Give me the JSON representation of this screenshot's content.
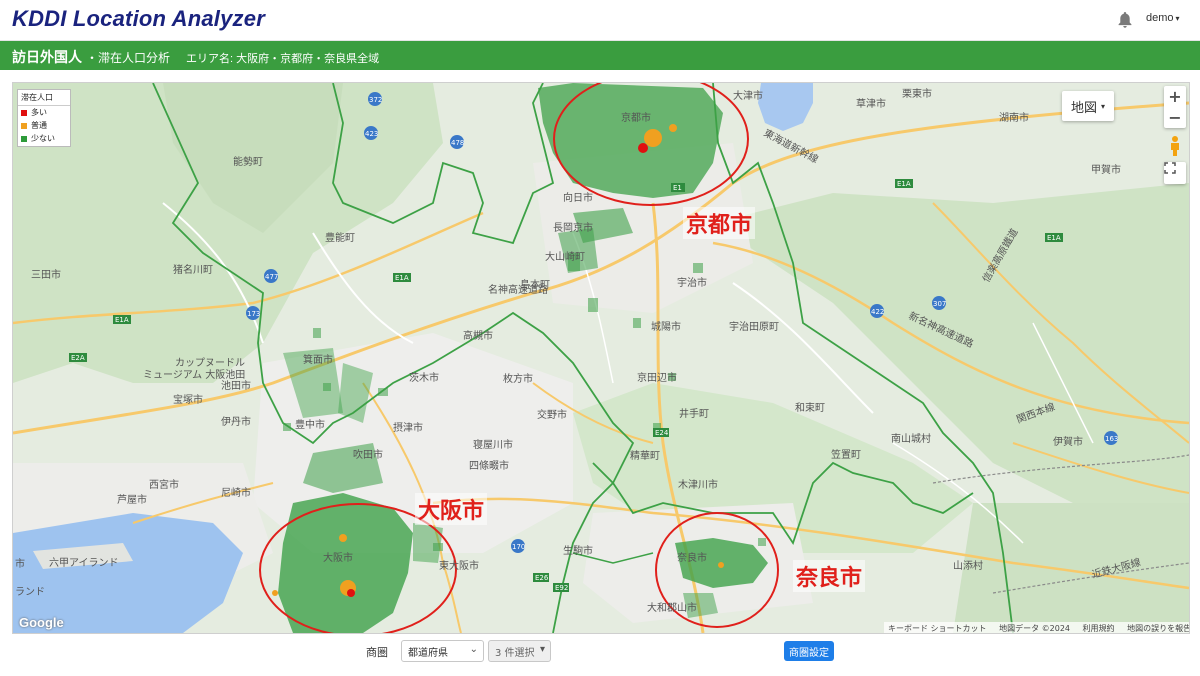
{
  "header": {
    "logo_kddi": "KDDI",
    "logo_rest": " Location Analyzer",
    "bell_icon": "bell-icon",
    "user_menu": "demo"
  },
  "title_bar": {
    "main": "訪日外国人",
    "sub": "・滞在人口分析",
    "area": "エリア名: 大阪府・京都府・奈良県全域"
  },
  "legend": {
    "title": "滞在人口",
    "items": [
      {
        "label": "多い",
        "color": "#e01010"
      },
      {
        "label": "普通",
        "color": "#f0a020"
      },
      {
        "label": "少ない",
        "color": "#2e9b3a"
      }
    ]
  },
  "map_controls": {
    "map_type": "地図",
    "zoom_in": "+",
    "zoom_out": "−",
    "pegman_icon": "pegman-icon",
    "fullscreen_icon": "fullscreen-icon"
  },
  "map_labels": {
    "kyoto_map": "京都市",
    "otsu": "大津市",
    "kusatsu": "草津市",
    "ritto": "栗東市",
    "konan": "湖南市",
    "koka": "甲賀市",
    "nose": "能勢町",
    "toyono": "豊能町",
    "inagawa": "猪名川町",
    "sanda": "三田市",
    "nagaokakyo": "長岡京市",
    "oyamazaki": "大山崎町",
    "shimamoto": "島本町",
    "mukou": "向日市",
    "uji": "宇治市",
    "ujitawara": "宇治田原町",
    "jouyou": "城陽市",
    "kyotanabe": "京田辺市",
    "takatsuki": "高槻市",
    "hirakata": "枚方市",
    "ibaraki": "茨木市",
    "minoh": "箕面市",
    "cupnoodle": "カップヌードル",
    "museum": "ミュージアム 大阪池田",
    "ikeda": "池田市",
    "takarazuka": "宝塚市",
    "itami": "伊丹市",
    "toyonaka": "豊中市",
    "settsu": "摂津市",
    "suita": "吹田市",
    "katano": "交野市",
    "neyagawa": "寝屋川市",
    "shijonawate": "四條畷市",
    "ide": "井手町",
    "seika": "精華町",
    "kizugawa": "木津川市",
    "wazuka": "和束町",
    "minamiyamashiro": "南山城村",
    "kasagi": "笠置町",
    "nishinomiya": "西宮市",
    "amagasaki": "尼崎市",
    "ashiya": "芦屋市",
    "osaka_map": "大阪市",
    "higashiosaka": "東大阪市",
    "ikoma": "生駒市",
    "nara_map": "奈良市",
    "yamato": "大和郡山市",
    "yamazoe": "山添村",
    "iga": "伊賀市",
    "rokko": "六甲アイランド",
    "kobe_edge": "市",
    "port_island": "ランド",
    "meishin": "名神高速道路",
    "keiji_bypass": "東海道新幹線",
    "shinmeishin": "新名神高速道路",
    "kansai_line": "関西本線",
    "kintetsu": "近鉄大阪線",
    "shigaraki": "信楽高原鐵道",
    "route_e1a_1": "E1A",
    "route_e1a_2": "E1A",
    "route_e1a_3": "E1A",
    "route_e1a_4": "E1A",
    "route_e2a": "E2A",
    "route_e1": "E1",
    "route_e24": "E24",
    "route_e26": "E26",
    "route_e92": "E92",
    "route_170": "170",
    "route_163": "163",
    "route_307": "307",
    "route_422": "422",
    "route_173": "173",
    "route_477": "477",
    "route_423": "423",
    "route_478": "478",
    "route_372": "372"
  },
  "city_annotations": {
    "kyoto": "京都市",
    "osaka": "大阪市",
    "nara": "奈良市"
  },
  "map_attribution": {
    "google": "Google",
    "shortcuts": "キーボード ショートカット",
    "data": "地図データ ©2024",
    "terms": "利用規約",
    "report": "地図の誤りを報告する"
  },
  "bottom_controls": {
    "label": "商圏",
    "prefecture_select": "都道府県",
    "count_select": "3 件選択",
    "apply_button": "商圏設定"
  },
  "colors": {
    "brand_green": "#3a9d3f",
    "annotation_red": "#e0201b",
    "primary_button": "#1e7ee8",
    "logo_navy": "#1a237e"
  }
}
